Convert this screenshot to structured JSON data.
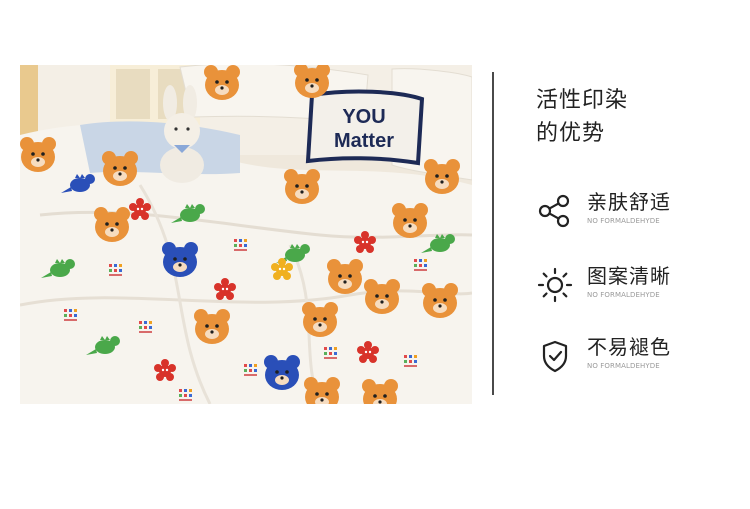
{
  "photo": {
    "pillow_text_line1": "YOU",
    "pillow_text_line2": "Matter"
  },
  "heading": {
    "line1": "活性印染",
    "line2": "的优势"
  },
  "features": [
    {
      "icon": "share-nodes-icon",
      "title": "亲肤舒适",
      "subtitle": "NO FORMALDEHYDE"
    },
    {
      "icon": "sun-icon",
      "title": "图案清晰",
      "subtitle": "NO FORMALDEHYDE"
    },
    {
      "icon": "shield-check-icon",
      "title": "不易褪色",
      "subtitle": "NO FORMALDEHYDE"
    }
  ],
  "colors": {
    "text": "#222222",
    "subtext": "#9a9a9a",
    "divider": "#4a4a4a",
    "bear_orange": "#e9923a",
    "bear_blue": "#2a4fb8",
    "bear_red": "#d8332a",
    "dino_green": "#4aa84a"
  }
}
